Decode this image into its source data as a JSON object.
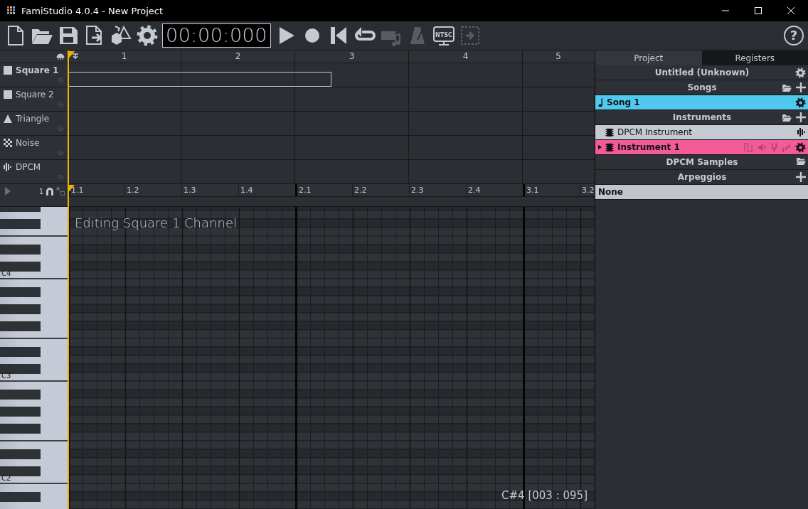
{
  "window": {
    "title": "FamiStudio 4.0.4 - New Project"
  },
  "toolbar": {
    "tools": [
      {
        "kind": "new",
        "disabled": false
      },
      {
        "kind": "open",
        "disabled": false
      },
      {
        "kind": "save",
        "disabled": false
      },
      {
        "kind": "export",
        "disabled": false
      },
      {
        "kind": "shapes",
        "disabled": false
      },
      {
        "kind": "config",
        "disabled": false
      },
      {
        "kind": "clock",
        "value": "00:00:000",
        "disabled": false
      },
      {
        "kind": "play",
        "disabled": false
      },
      {
        "kind": "record",
        "disabled": false
      },
      {
        "kind": "rewind",
        "disabled": false
      },
      {
        "kind": "loop",
        "disabled": false
      },
      {
        "kind": "qwerty",
        "disabled": true
      },
      {
        "kind": "metronome",
        "disabled": true
      },
      {
        "kind": "machine",
        "label": "NTSC",
        "disabled": false
      },
      {
        "kind": "follow",
        "disabled": true
      }
    ],
    "help": "?"
  },
  "sequencer": {
    "measures": [
      "1",
      "2",
      "3",
      "4",
      "5"
    ],
    "channels": [
      {
        "name": "Square 1",
        "kind": "square",
        "selected": true
      },
      {
        "name": "Square 2",
        "kind": "square",
        "selected": false
      },
      {
        "name": "Triangle",
        "kind": "triangle",
        "selected": false
      },
      {
        "name": "Noise",
        "kind": "noise",
        "selected": false
      },
      {
        "name": "DPCM",
        "kind": "dpcm",
        "selected": false
      }
    ]
  },
  "piano_roll": {
    "snap": "1",
    "beats": [
      "1.1",
      "1.2",
      "1.3",
      "1.4",
      "2.1",
      "2.2",
      "2.3",
      "2.4",
      "3.1",
      "3.2"
    ],
    "octaves": [
      "C4",
      "C3",
      "C2"
    ],
    "message": "Editing Square 1 Channel",
    "status": "C#4 [003 : 095]"
  },
  "project_panel": {
    "tabs": [
      {
        "label": "Project",
        "selected": true
      },
      {
        "label": "Registers",
        "selected": false
      }
    ],
    "rows": [
      {
        "kind": "header",
        "label": "Untitled (Unknown)",
        "actions": [
          {
            "kind": "gear",
            "dimmed": false
          }
        ]
      },
      {
        "kind": "header",
        "label": "Songs",
        "actions": [
          {
            "kind": "folder",
            "dimmed": false
          },
          {
            "kind": "add",
            "dimmed": false
          }
        ]
      },
      {
        "kind": "song",
        "label": "Song 1",
        "color": "#50c8ef",
        "actions": [
          {
            "kind": "gear",
            "dimmed": false
          }
        ]
      },
      {
        "kind": "header",
        "label": "Instruments",
        "actions": [
          {
            "kind": "folder",
            "dimmed": false
          },
          {
            "kind": "add",
            "dimmed": false
          }
        ]
      },
      {
        "kind": "instrument",
        "label": "DPCM Instrument",
        "color": "#c5c9d2",
        "actions": [
          {
            "kind": "dpcm",
            "dimmed": false
          }
        ]
      },
      {
        "kind": "instrument",
        "label": "Instrument 1",
        "color": "#f25a98",
        "expanded": false,
        "actions": [
          {
            "kind": "duty",
            "dimmed": true
          },
          {
            "kind": "volume",
            "dimmed": true
          },
          {
            "kind": "pitch",
            "dimmed": true
          },
          {
            "kind": "arpeggio",
            "dimmed": true
          },
          {
            "kind": "gear",
            "dimmed": false
          }
        ]
      },
      {
        "kind": "header",
        "label": "DPCM Samples",
        "actions": [
          {
            "kind": "folder",
            "dimmed": false
          }
        ]
      },
      {
        "kind": "header",
        "label": "Arpeggios",
        "actions": [
          {
            "kind": "add",
            "dimmed": false
          }
        ]
      },
      {
        "kind": "item",
        "label": "None",
        "color": "#c0c4cc"
      }
    ]
  }
}
